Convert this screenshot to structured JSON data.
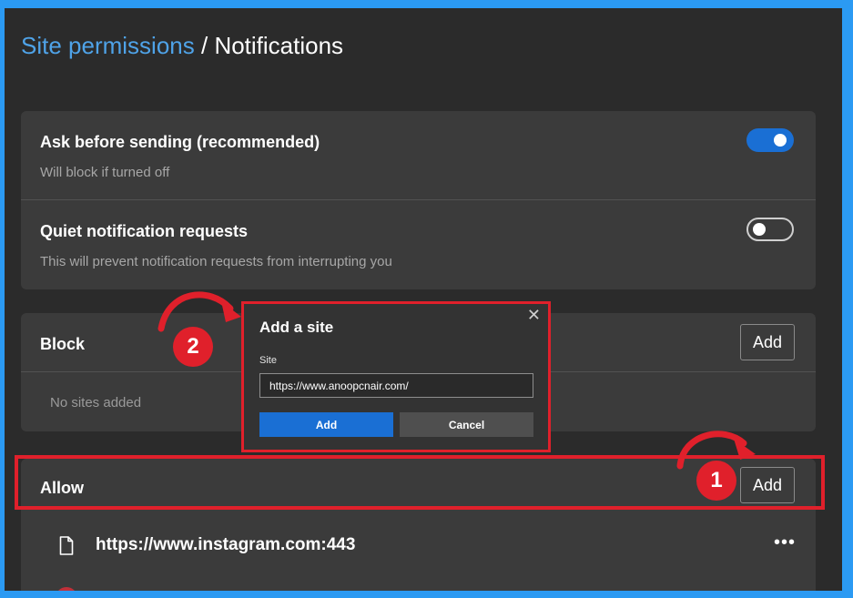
{
  "header": {
    "breadcrumb_parent": "Site permissions",
    "separator": "/",
    "page_title": "Notifications"
  },
  "settings": [
    {
      "title": "Ask before sending (recommended)",
      "subtitle": "Will block if turned off",
      "enabled": true
    },
    {
      "title": "Quiet notification requests",
      "subtitle": "This will prevent notification requests from interrupting you",
      "enabled": false
    }
  ],
  "block_section": {
    "title": "Block",
    "add_label": "Add",
    "empty_text": "No sites added"
  },
  "allow_section": {
    "title": "Allow",
    "add_label": "Add",
    "sites": [
      {
        "url": "https://www.instagram.com:443"
      }
    ]
  },
  "dialog": {
    "title": "Add a site",
    "field_label": "Site",
    "field_value": "https://www.anoopcnair.com/",
    "add_label": "Add",
    "cancel_label": "Cancel"
  },
  "annotations": {
    "step1": "1",
    "step2": "2"
  },
  "colors": {
    "accent": "#1a6fd4",
    "highlight": "#e0202b",
    "frame": "#2b9af3",
    "link": "#4fa3e8"
  }
}
